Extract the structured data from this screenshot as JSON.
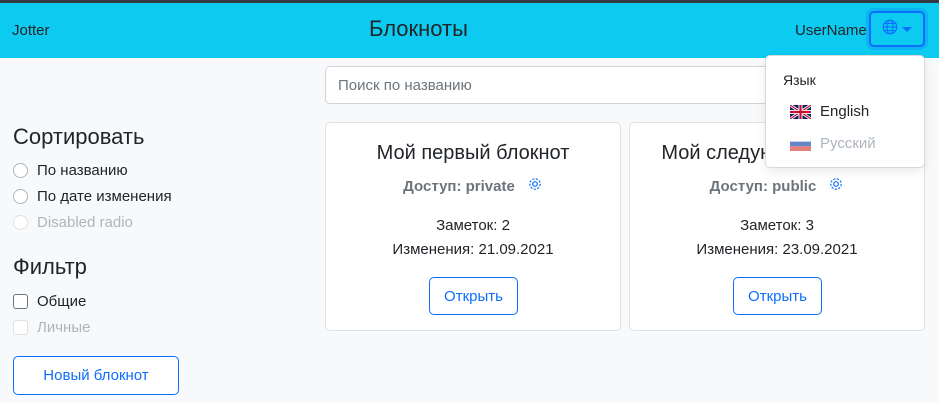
{
  "navbar": {
    "brand": "Jotter",
    "title": "Блокноты",
    "username": "UserName",
    "language_icon": "globe-icon",
    "accent": "#0dcaf0"
  },
  "search": {
    "placeholder": "Поиск по названию",
    "value": ""
  },
  "sidebar": {
    "sort_heading": "Сортировать",
    "sort_options": [
      "По названию",
      "По дате изменения",
      "Disabled radio"
    ],
    "filter_heading": "Фильтр",
    "filter_options": [
      "Общие",
      "Личные"
    ],
    "new_notebook": "Новый блокнот"
  },
  "notebooks": [
    {
      "title": "Мой первый блокнот",
      "access": "Доступ: private",
      "notes": "Заметок: 2",
      "changed": "Изменения: 21.09.2021",
      "open": "Открыть"
    },
    {
      "title": "Мой следующий блокнот",
      "access": "Доступ: public",
      "notes": "Заметок: 3",
      "changed": "Изменения: 23.09.2021",
      "open": "Открыть"
    }
  ],
  "language_menu": {
    "header": "Язык",
    "items": [
      {
        "label": "English",
        "flag": "uk-flag-icon",
        "disabled": false
      },
      {
        "label": "Русский",
        "flag": "ru-flag-icon",
        "disabled": true
      }
    ]
  },
  "colors": {
    "primary": "#0d6efd",
    "muted": "#6c757d",
    "disabled": "#adb5bd"
  }
}
